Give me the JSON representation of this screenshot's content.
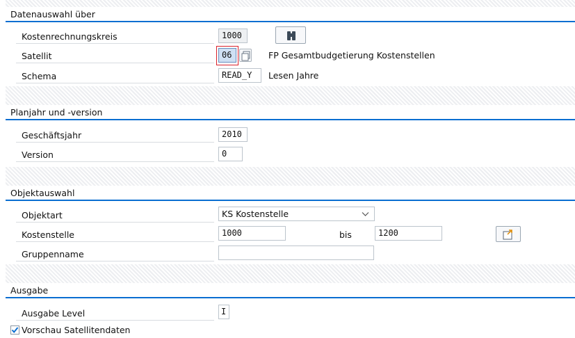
{
  "sections": {
    "data_selection": {
      "title": "Datenauswahl über",
      "controlling_area_label": "Kostenrechnungskreis",
      "controlling_area_value": "1000",
      "satellite_label": "Satellit",
      "satellite_value": "06",
      "satellite_desc": "FP Gesamtbudgetierung Kostenstellen",
      "schema_label": "Schema",
      "schema_value": "READ_Y",
      "schema_desc": "Lesen Jahre"
    },
    "plan": {
      "title": "Planjahr und -version",
      "fiscal_year_label": "Geschäftsjahr",
      "fiscal_year_value": "2010",
      "version_label": "Version",
      "version_value": "0"
    },
    "objects": {
      "title": "Objektauswahl",
      "object_type_label": "Objektart",
      "object_type_value": "KS Kostenstelle",
      "cost_center_label": "Kostenstelle",
      "cost_center_from": "1000",
      "to_label": "bis",
      "cost_center_to": "1200",
      "group_label": "Gruppenname",
      "group_value": ""
    },
    "output": {
      "title": "Ausgabe",
      "level_label": "Ausgabe Level",
      "level_value": "I",
      "preview_label": "Vorschau Satellitendaten",
      "preview_checked": true
    }
  },
  "icons": {
    "binoculars": "binoculars-icon",
    "copy": "copy-icon",
    "multiple_selection": "multiple-selection-icon",
    "chevron": "chevron-down-icon",
    "checkbox": "checkbox-checked-icon"
  },
  "colors": {
    "accent": "#0a6ed1",
    "focus": "#d9202b",
    "check": "#0a6ed1"
  }
}
